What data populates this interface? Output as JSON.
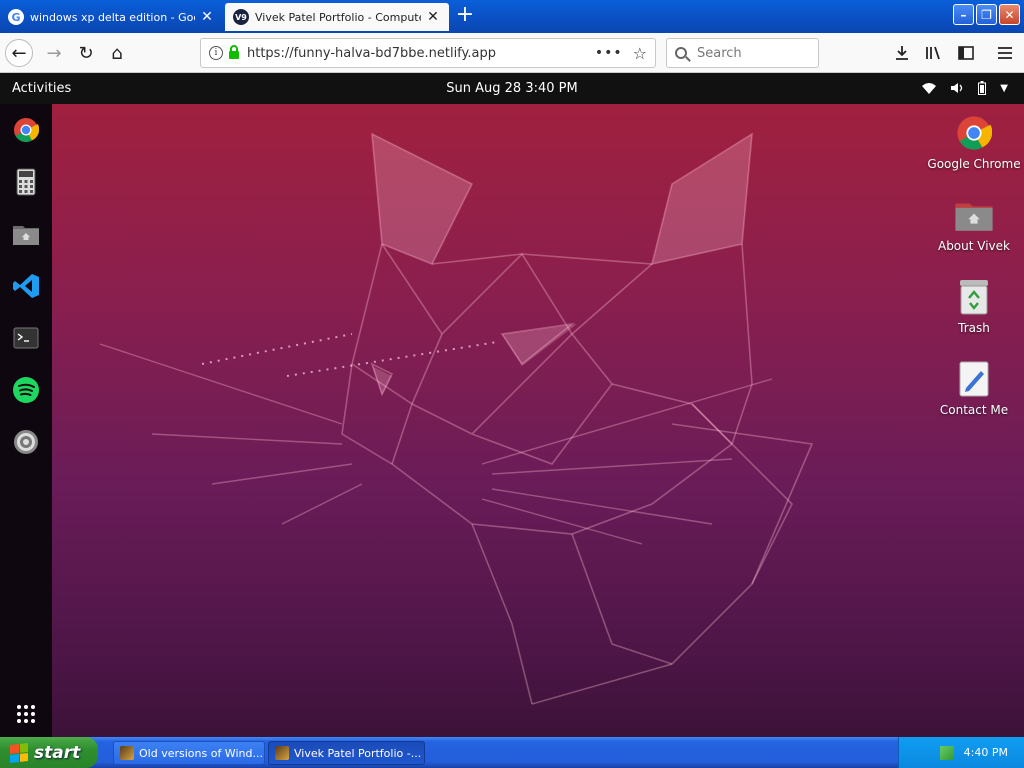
{
  "browser": {
    "tabs": [
      {
        "title": "windows xp delta edition - Google Search",
        "favicon": "google-g-icon",
        "active": false
      },
      {
        "title": "Vivek Patel Portfolio - Computer Engineer",
        "favicon": "portfolio-favicon",
        "favicon_text": "V9",
        "active": true
      }
    ],
    "url": "https://funny-halva-bd7bbe.netlify.app",
    "search_placeholder": "Search",
    "url_more": "•••"
  },
  "ubuntu": {
    "activities_label": "Activities",
    "clock": "Sun Aug 28  3:40 PM",
    "dock": [
      "chrome-icon",
      "calculator-icon",
      "files-icon",
      "vscode-icon",
      "terminal-icon",
      "spotify-icon",
      "settings-icon",
      "app-grid-icon"
    ],
    "desktop_icons": [
      {
        "label": "Google Chrome",
        "icon": "chrome-icon"
      },
      {
        "label": "About Vivek",
        "icon": "home-folder-icon"
      },
      {
        "label": "Trash",
        "icon": "trash-icon"
      },
      {
        "label": "Contact Me",
        "icon": "contact-edit-icon"
      }
    ]
  },
  "taskbar": {
    "start_label": "start",
    "items": [
      {
        "title": "Old versions of Wind...",
        "active": false
      },
      {
        "title": "Vivek Patel Portfolio -...",
        "active": true
      }
    ],
    "time": "4:40 PM"
  },
  "colors": {
    "xp_blue": "#245edb",
    "start_green": "#2f8f2f",
    "ubuntu_red": "#a0203f",
    "ubuntu_purple": "#4f1648"
  }
}
